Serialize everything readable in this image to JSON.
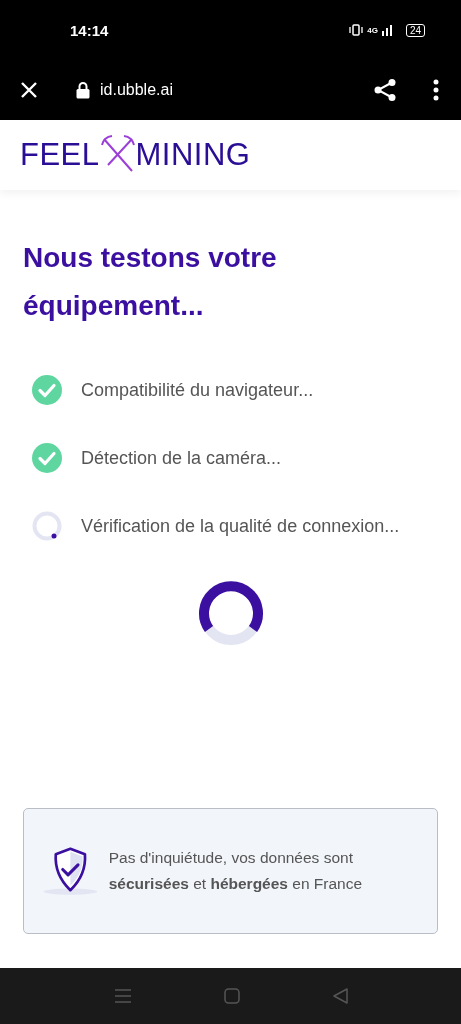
{
  "status_bar": {
    "time": "14:14",
    "network": "4G",
    "battery": "24"
  },
  "browser_bar": {
    "url": "id.ubble.ai"
  },
  "header": {
    "logo_left": "FEEL",
    "logo_right": "MINING"
  },
  "title": "Nous testons votre équipement...",
  "steps": [
    {
      "kind": "done",
      "label": "Compatibilité du navigateur..."
    },
    {
      "kind": "done",
      "label": "Détection de la caméra..."
    },
    {
      "kind": "pending",
      "label": "Vérification de la qualité de connexion..."
    }
  ],
  "notice": {
    "text": "Pas d'inquiétude, vos données sont **sécurisées** et **hébergées** en France"
  }
}
